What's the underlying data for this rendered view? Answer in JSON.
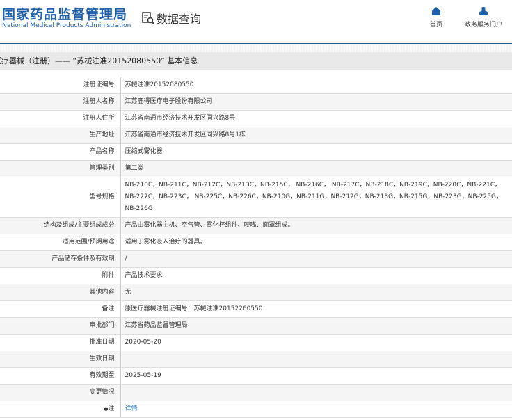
{
  "header": {
    "logo_cn": "国家药品监督管理局",
    "logo_en": "National Medical Products Administration",
    "title": "数据查询",
    "nav": [
      {
        "label": "首页",
        "icon": "home-icon"
      },
      {
        "label": "政务服务门户",
        "icon": "user-icon"
      }
    ]
  },
  "page_title": "医疗器械（注册）—— “苏械注准20152080550” 基本信息",
  "rows": [
    {
      "label": "注册证编号",
      "value": "苏械注准20152080550"
    },
    {
      "label": "注册人名称",
      "value": "江苏鹿得医疗电子股份有限公司"
    },
    {
      "label": "注册人住所",
      "value": "江苏省南通市经济技术开发区同兴路8号"
    },
    {
      "label": "生产地址",
      "value": "江苏省南通市经济技术开发区同兴路8号1栋"
    },
    {
      "label": "产品名称",
      "value": "压缩式雾化器"
    },
    {
      "label": "管理类别",
      "value": "第二类"
    },
    {
      "label": "型号规格",
      "value": "NB-210C，NB-211C，NB-212C，NB-213C，NB-215C， NB-216C， NB-217C，NB-218C，NB-219C，NB-220C，NB-221C，NB-222C，NB-223C， NB-225C，NB-226C，NB-210G，NB-211G，NB-212G，NB-213G，NB-215G，NB-223G，NB-225G，NB-226G"
    },
    {
      "label": "结构及组成/主要组成成分",
      "value": "产品由雾化器主机、空气管、雾化杯组件、咬嘴、面罩组成。"
    },
    {
      "label": "适用范围/预期用途",
      "value": "适用于雾化吸入治疗的器具。"
    },
    {
      "label": "产品储存条件及有效期",
      "value": "/"
    },
    {
      "label": "附件",
      "value": "产品技术要求"
    },
    {
      "label": "其他内容",
      "value": "无"
    },
    {
      "label": "备注",
      "value": "原医疗器械注册证编号：苏械注准20152260550"
    },
    {
      "label": "审批部门",
      "value": "江苏省药品监督管理局"
    },
    {
      "label": "批准日期",
      "value": "2020-05-20"
    },
    {
      "label": "生效日期",
      "value": ""
    },
    {
      "label": "有效期至",
      "value": "2025-05-19"
    },
    {
      "label": "变更情况",
      "value": ""
    },
    {
      "label": "注",
      "value": "详情"
    }
  ]
}
